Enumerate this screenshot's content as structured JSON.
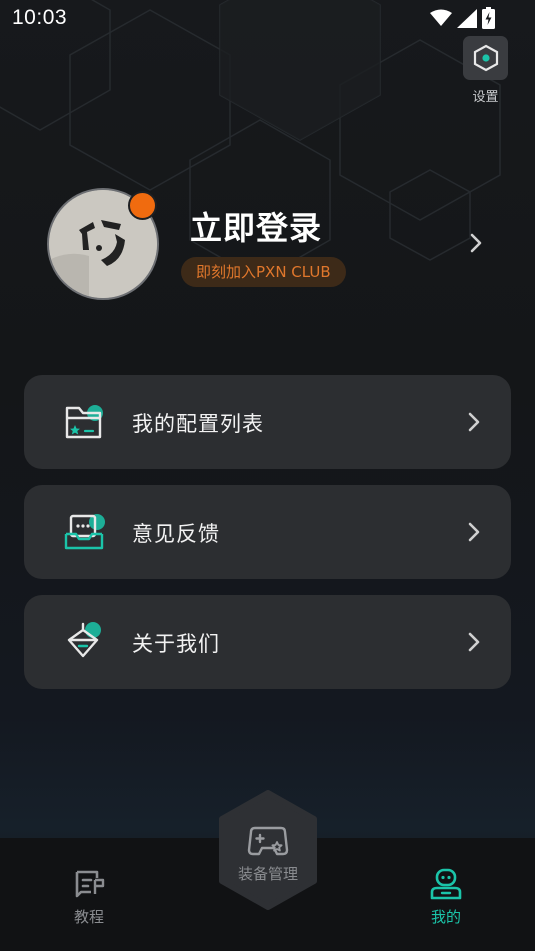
{
  "status_bar": {
    "time": "10:03"
  },
  "settings": {
    "label": "设置",
    "icon": "hexagon-settings-icon"
  },
  "profile": {
    "title": "立即登录",
    "badge": "即刻加入PXN CLUB",
    "notification_color": "#f06b0f"
  },
  "menu": {
    "items": [
      {
        "label": "我的配置列表",
        "icon": "folder-star-icon"
      },
      {
        "label": "意见反馈",
        "icon": "feedback-inbox-icon"
      },
      {
        "label": "关于我们",
        "icon": "shield-about-icon"
      }
    ]
  },
  "bottom_nav": {
    "tutorial": {
      "label": "教程",
      "icon": "tutorial-flag-icon"
    },
    "device": {
      "label": "装备管理",
      "icon": "gamepad-icon"
    },
    "mine": {
      "label": "我的",
      "icon": "robot-user-icon",
      "active": true
    }
  },
  "colors": {
    "accent": "#1bc4a9",
    "badge_text": "#e0772c",
    "card_bg": "#2c2e31"
  }
}
